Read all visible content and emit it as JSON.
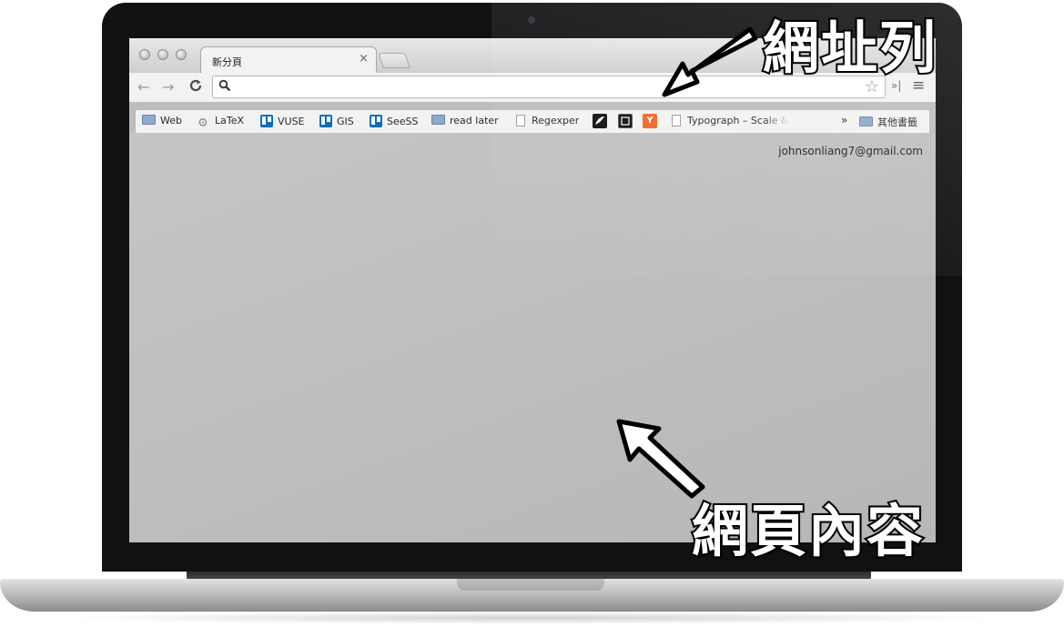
{
  "browser": {
    "tab_title": "新分頁",
    "tab_close": "×",
    "back_icon": "←",
    "forward_icon": "→",
    "reload_icon": "C",
    "omnibox_value": "",
    "search_icon": "🔍",
    "star_icon": "☆",
    "extensions_more": "»|",
    "menu_icon": "≡"
  },
  "bookmarks": {
    "items": [
      {
        "label": "Web",
        "icon": "folder-icon"
      },
      {
        "label": "LaTeX",
        "icon": "gear-icon"
      },
      {
        "label": "VUSE",
        "icon": "trello-icon"
      },
      {
        "label": "GIS",
        "icon": "trello-icon"
      },
      {
        "label": "SeeSS",
        "icon": "trello-icon"
      },
      {
        "label": "read later",
        "icon": "folder-icon"
      },
      {
        "label": "Regexper",
        "icon": "page-icon"
      },
      {
        "label": "",
        "icon": "brush-icon"
      },
      {
        "label": "",
        "icon": "dark-square-icon"
      },
      {
        "label": "Y",
        "icon": "ycombinator-icon"
      },
      {
        "label": "Typograph – Scale &",
        "icon": "page-icon"
      }
    ],
    "more": "»",
    "other": "其他書籤"
  },
  "content": {
    "user_email": "johnsonliang7@gmail.com"
  },
  "annotations": {
    "url_bar": "網址列",
    "web_content": "網頁內容"
  },
  "colors": {
    "ycombinator": "#f26522",
    "trello": "#0b6fb8"
  }
}
